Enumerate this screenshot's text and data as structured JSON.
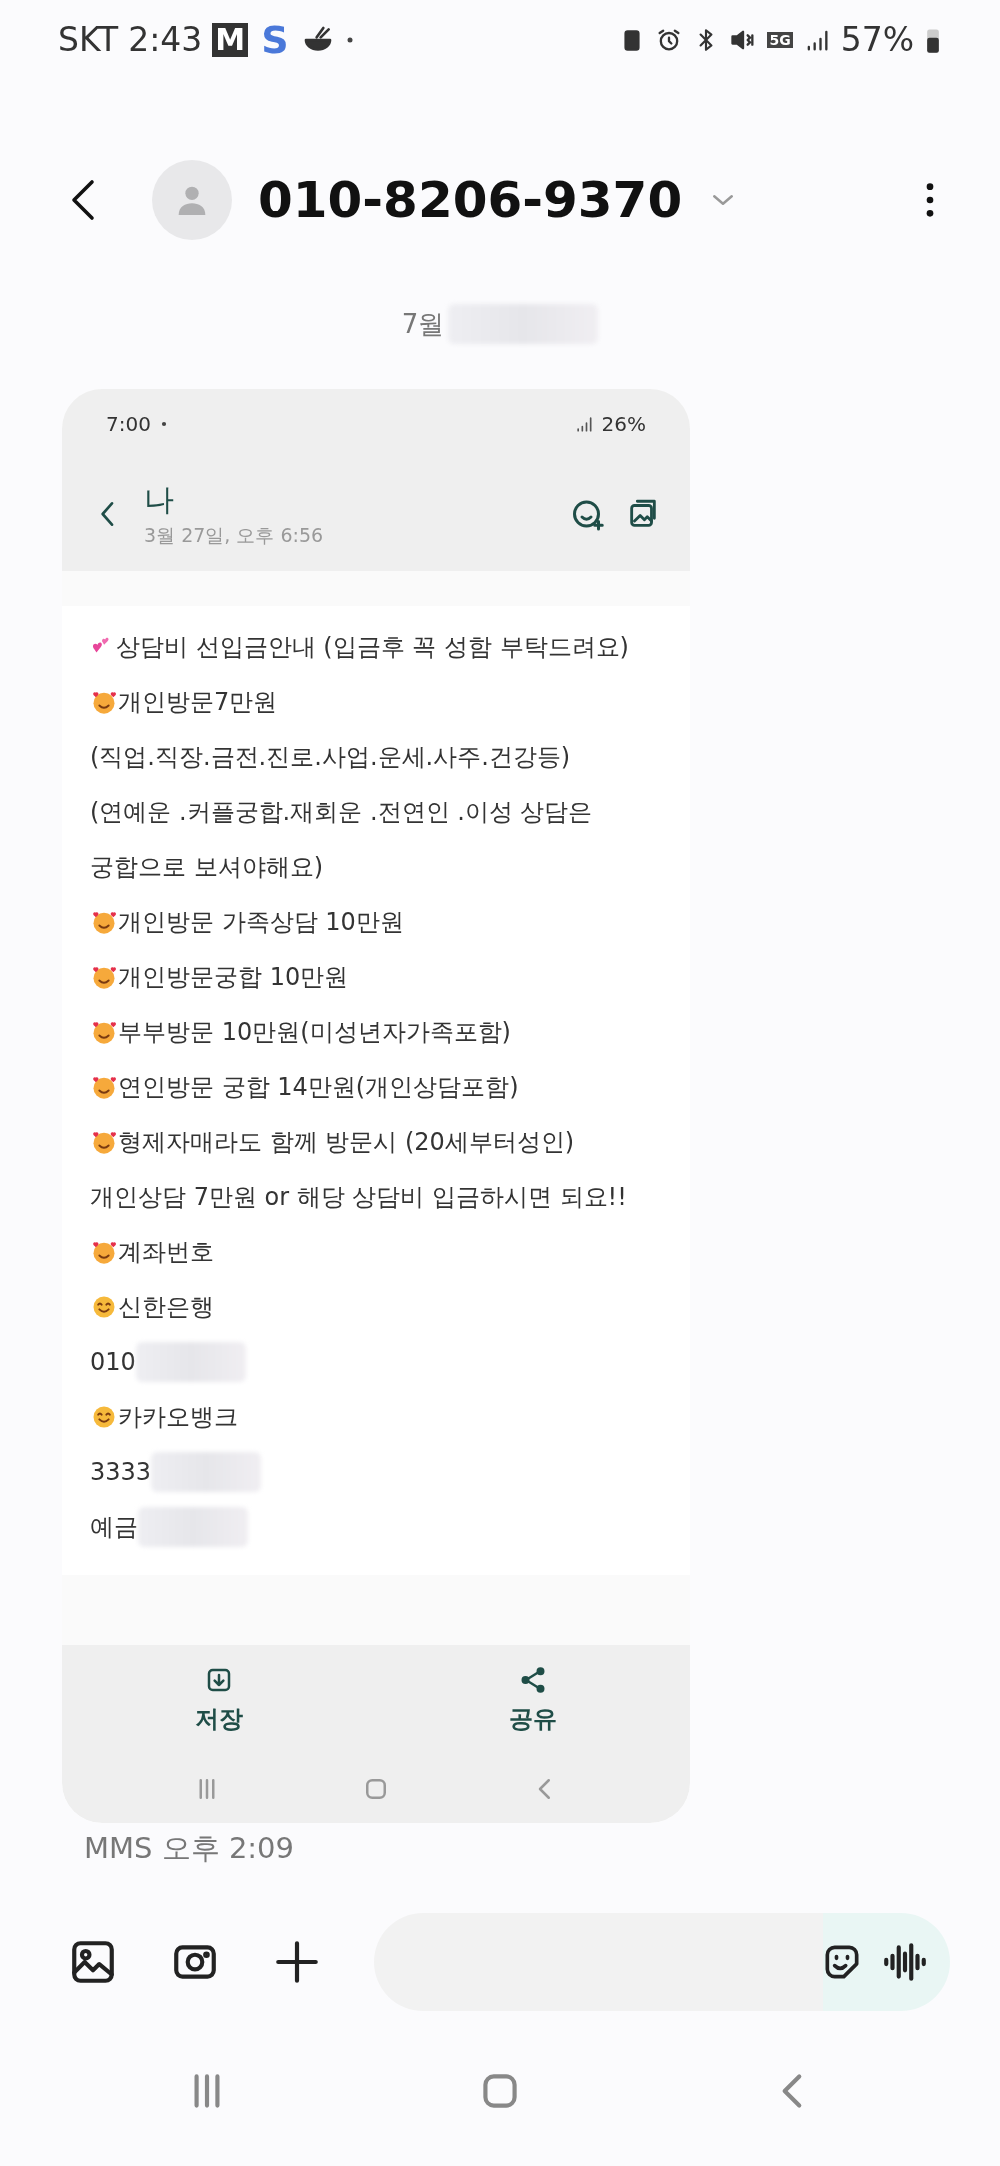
{
  "status_bar": {
    "carrier": "SKT",
    "time": "2:43",
    "app_badges": [
      {
        "letter": "M",
        "kind": "boxed"
      },
      {
        "letter": "S",
        "kind": "plain"
      }
    ],
    "battery": "57%",
    "network": "5G"
  },
  "header": {
    "title": "010-8206-9370"
  },
  "date_label": "7월",
  "attachment": {
    "inner_status": {
      "time": "7:00",
      "battery": "26%"
    },
    "inner_header": {
      "title": "나",
      "subtitle": "3월 27일, 오후 6:56"
    },
    "lines": [
      {
        "text": "상담비 선입금안내 (입금후 꼭 성함 부탁드려요)",
        "kind": "hearts"
      },
      {
        "text": "개인방문7만원",
        "kind": "loveface"
      },
      {
        "text": "(직업.직장.금전.진로.사업.운세.사주.건강등)",
        "kind": "plain"
      },
      {
        "text": "(연예운 .커플궁합.재회운 .전연인 .이성 상담은",
        "kind": "plain"
      },
      {
        "text": "궁합으로 보셔야해요)",
        "kind": "plain"
      },
      {
        "text": "개인방문 가족상담 10만원",
        "kind": "loveface"
      },
      {
        "text": "개인방문궁합 10만원",
        "kind": "loveface"
      },
      {
        "text": "부부방문 10만원(미성년자가족포함)",
        "kind": "loveface"
      },
      {
        "text": "연인방문 궁합 14만원(개인상담포함)",
        "kind": "loveface"
      },
      {
        "text": "형제자매라도  함께 방문시 (20세부터성인)",
        "kind": "loveface"
      },
      {
        "text": "개인상담 7만원 or 해당 상담비 입금하시면 되요!!",
        "kind": "plain"
      },
      {
        "text": "계좌번호",
        "kind": "loveface"
      },
      {
        "text": "신한은행",
        "kind": "smile"
      },
      {
        "text": "010",
        "kind": "plain",
        "redacted": true
      },
      {
        "text": "카카오뱅크",
        "kind": "smile"
      },
      {
        "text": "3333",
        "kind": "plain",
        "redacted": true
      },
      {
        "text": "예금",
        "kind": "plain",
        "redacted": true
      }
    ],
    "actions": [
      {
        "label": "저장",
        "kind": "save"
      },
      {
        "label": "공유",
        "kind": "share"
      }
    ]
  },
  "message_meta": "MMS 오후 2:09"
}
